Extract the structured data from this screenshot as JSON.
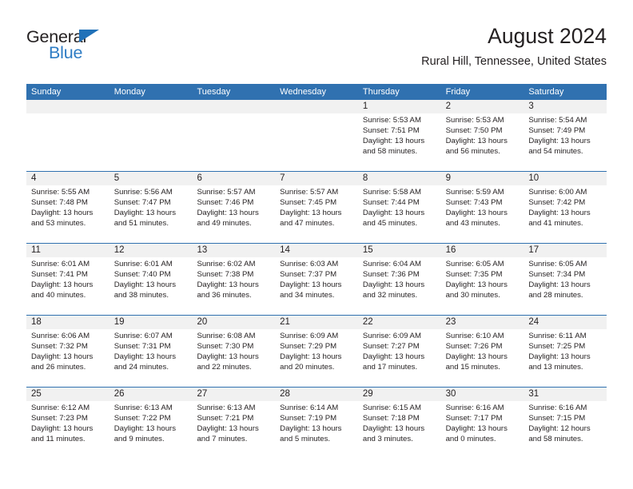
{
  "brand": {
    "name_part1": "General",
    "name_part2": "Blue",
    "triangle_color": "#2071b8",
    "blue_color": "#2e7cc4"
  },
  "header": {
    "title": "August 2024",
    "subtitle": "Rural Hill, Tennessee, United States"
  },
  "colors": {
    "header_blue": "#3071b0",
    "date_band": "#f1f1f1",
    "text": "#231f20"
  },
  "weekdays": [
    "Sunday",
    "Monday",
    "Tuesday",
    "Wednesday",
    "Thursday",
    "Friday",
    "Saturday"
  ],
  "weeks": [
    {
      "days": [
        {
          "num": "",
          "lines": []
        },
        {
          "num": "",
          "lines": []
        },
        {
          "num": "",
          "lines": []
        },
        {
          "num": "",
          "lines": []
        },
        {
          "num": "1",
          "lines": [
            "Sunrise: 5:53 AM",
            "Sunset: 7:51 PM",
            "Daylight: 13 hours",
            "and 58 minutes."
          ]
        },
        {
          "num": "2",
          "lines": [
            "Sunrise: 5:53 AM",
            "Sunset: 7:50 PM",
            "Daylight: 13 hours",
            "and 56 minutes."
          ]
        },
        {
          "num": "3",
          "lines": [
            "Sunrise: 5:54 AM",
            "Sunset: 7:49 PM",
            "Daylight: 13 hours",
            "and 54 minutes."
          ]
        }
      ]
    },
    {
      "days": [
        {
          "num": "4",
          "lines": [
            "Sunrise: 5:55 AM",
            "Sunset: 7:48 PM",
            "Daylight: 13 hours",
            "and 53 minutes."
          ]
        },
        {
          "num": "5",
          "lines": [
            "Sunrise: 5:56 AM",
            "Sunset: 7:47 PM",
            "Daylight: 13 hours",
            "and 51 minutes."
          ]
        },
        {
          "num": "6",
          "lines": [
            "Sunrise: 5:57 AM",
            "Sunset: 7:46 PM",
            "Daylight: 13 hours",
            "and 49 minutes."
          ]
        },
        {
          "num": "7",
          "lines": [
            "Sunrise: 5:57 AM",
            "Sunset: 7:45 PM",
            "Daylight: 13 hours",
            "and 47 minutes."
          ]
        },
        {
          "num": "8",
          "lines": [
            "Sunrise: 5:58 AM",
            "Sunset: 7:44 PM",
            "Daylight: 13 hours",
            "and 45 minutes."
          ]
        },
        {
          "num": "9",
          "lines": [
            "Sunrise: 5:59 AM",
            "Sunset: 7:43 PM",
            "Daylight: 13 hours",
            "and 43 minutes."
          ]
        },
        {
          "num": "10",
          "lines": [
            "Sunrise: 6:00 AM",
            "Sunset: 7:42 PM",
            "Daylight: 13 hours",
            "and 41 minutes."
          ]
        }
      ]
    },
    {
      "days": [
        {
          "num": "11",
          "lines": [
            "Sunrise: 6:01 AM",
            "Sunset: 7:41 PM",
            "Daylight: 13 hours",
            "and 40 minutes."
          ]
        },
        {
          "num": "12",
          "lines": [
            "Sunrise: 6:01 AM",
            "Sunset: 7:40 PM",
            "Daylight: 13 hours",
            "and 38 minutes."
          ]
        },
        {
          "num": "13",
          "lines": [
            "Sunrise: 6:02 AM",
            "Sunset: 7:38 PM",
            "Daylight: 13 hours",
            "and 36 minutes."
          ]
        },
        {
          "num": "14",
          "lines": [
            "Sunrise: 6:03 AM",
            "Sunset: 7:37 PM",
            "Daylight: 13 hours",
            "and 34 minutes."
          ]
        },
        {
          "num": "15",
          "lines": [
            "Sunrise: 6:04 AM",
            "Sunset: 7:36 PM",
            "Daylight: 13 hours",
            "and 32 minutes."
          ]
        },
        {
          "num": "16",
          "lines": [
            "Sunrise: 6:05 AM",
            "Sunset: 7:35 PM",
            "Daylight: 13 hours",
            "and 30 minutes."
          ]
        },
        {
          "num": "17",
          "lines": [
            "Sunrise: 6:05 AM",
            "Sunset: 7:34 PM",
            "Daylight: 13 hours",
            "and 28 minutes."
          ]
        }
      ]
    },
    {
      "days": [
        {
          "num": "18",
          "lines": [
            "Sunrise: 6:06 AM",
            "Sunset: 7:32 PM",
            "Daylight: 13 hours",
            "and 26 minutes."
          ]
        },
        {
          "num": "19",
          "lines": [
            "Sunrise: 6:07 AM",
            "Sunset: 7:31 PM",
            "Daylight: 13 hours",
            "and 24 minutes."
          ]
        },
        {
          "num": "20",
          "lines": [
            "Sunrise: 6:08 AM",
            "Sunset: 7:30 PM",
            "Daylight: 13 hours",
            "and 22 minutes."
          ]
        },
        {
          "num": "21",
          "lines": [
            "Sunrise: 6:09 AM",
            "Sunset: 7:29 PM",
            "Daylight: 13 hours",
            "and 20 minutes."
          ]
        },
        {
          "num": "22",
          "lines": [
            "Sunrise: 6:09 AM",
            "Sunset: 7:27 PM",
            "Daylight: 13 hours",
            "and 17 minutes."
          ]
        },
        {
          "num": "23",
          "lines": [
            "Sunrise: 6:10 AM",
            "Sunset: 7:26 PM",
            "Daylight: 13 hours",
            "and 15 minutes."
          ]
        },
        {
          "num": "24",
          "lines": [
            "Sunrise: 6:11 AM",
            "Sunset: 7:25 PM",
            "Daylight: 13 hours",
            "and 13 minutes."
          ]
        }
      ]
    },
    {
      "days": [
        {
          "num": "25",
          "lines": [
            "Sunrise: 6:12 AM",
            "Sunset: 7:23 PM",
            "Daylight: 13 hours",
            "and 11 minutes."
          ]
        },
        {
          "num": "26",
          "lines": [
            "Sunrise: 6:13 AM",
            "Sunset: 7:22 PM",
            "Daylight: 13 hours",
            "and 9 minutes."
          ]
        },
        {
          "num": "27",
          "lines": [
            "Sunrise: 6:13 AM",
            "Sunset: 7:21 PM",
            "Daylight: 13 hours",
            "and 7 minutes."
          ]
        },
        {
          "num": "28",
          "lines": [
            "Sunrise: 6:14 AM",
            "Sunset: 7:19 PM",
            "Daylight: 13 hours",
            "and 5 minutes."
          ]
        },
        {
          "num": "29",
          "lines": [
            "Sunrise: 6:15 AM",
            "Sunset: 7:18 PM",
            "Daylight: 13 hours",
            "and 3 minutes."
          ]
        },
        {
          "num": "30",
          "lines": [
            "Sunrise: 6:16 AM",
            "Sunset: 7:17 PM",
            "Daylight: 13 hours",
            "and 0 minutes."
          ]
        },
        {
          "num": "31",
          "lines": [
            "Sunrise: 6:16 AM",
            "Sunset: 7:15 PM",
            "Daylight: 12 hours",
            "and 58 minutes."
          ]
        }
      ]
    }
  ]
}
